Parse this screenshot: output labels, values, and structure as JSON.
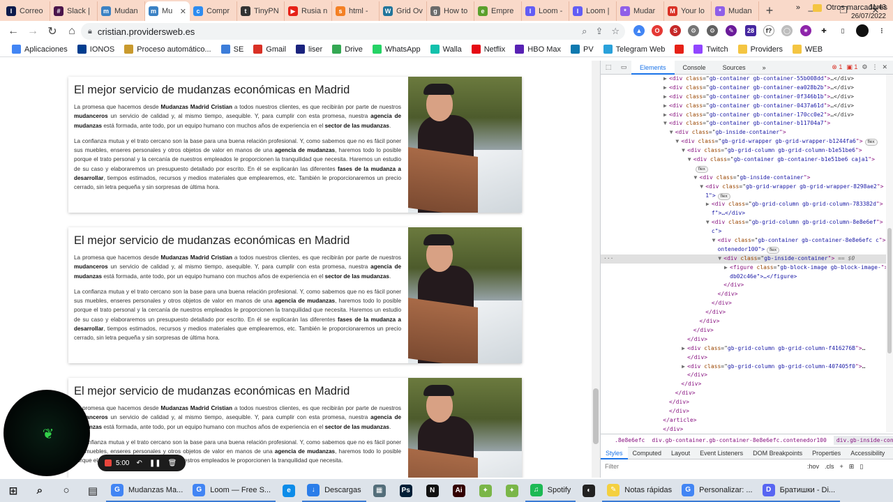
{
  "browser": {
    "tabs": [
      {
        "label": "Correo",
        "icon": "I",
        "color": "#0d1b4c"
      },
      {
        "label": "Slack |",
        "icon": "#",
        "color": "#4a154b"
      },
      {
        "label": "Mudan",
        "icon": "m",
        "color": "#3b82c4"
      },
      {
        "label": "Mu",
        "icon": "m",
        "color": "#3b82c4",
        "active": true
      },
      {
        "label": "Compr",
        "icon": "c",
        "color": "#2d8cf0"
      },
      {
        "label": "TinyPN",
        "icon": "t",
        "color": "#333333"
      },
      {
        "label": "Rusia n",
        "icon": "▶",
        "color": "#e62117"
      },
      {
        "label": "html -",
        "icon": "s",
        "color": "#f48024"
      },
      {
        "label": "Grid Ov",
        "icon": "W",
        "color": "#21759b"
      },
      {
        "label": "How to",
        "icon": "g",
        "color": "#6b6b6b"
      },
      {
        "label": "Empre",
        "icon": "e",
        "color": "#5aa02c"
      },
      {
        "label": "Loom -",
        "icon": "l",
        "color": "#625df5"
      },
      {
        "label": "Loom |",
        "icon": "l",
        "color": "#625df5"
      },
      {
        "label": "Mudar",
        "icon": "*",
        "color": "#8f5fe8"
      },
      {
        "label": "Your lo",
        "icon": "M",
        "color": "#d93025"
      },
      {
        "label": "Mudan",
        "icon": "*",
        "color": "#8f5fe8"
      }
    ],
    "new_tab": "+",
    "url": "cristian.providersweb.es",
    "bookmarks": [
      {
        "label": "Aplicaciones",
        "color": "#4285f4"
      },
      {
        "label": "IONOS",
        "color": "#003d8f"
      },
      {
        "label": "Proceso automático...",
        "color": "#c99a2e"
      },
      {
        "label": "SE",
        "color": "#3c7dd9"
      },
      {
        "label": "Gmail",
        "color": "#d93025"
      },
      {
        "label": "liser",
        "color": "#1a237e"
      },
      {
        "label": "Drive",
        "color": "#34a853"
      },
      {
        "label": "WhatsApp",
        "color": "#25d366"
      },
      {
        "label": "Walla",
        "color": "#13c1ac"
      },
      {
        "label": "Netflix",
        "color": "#e50914"
      },
      {
        "label": "HBO Max",
        "color": "#5822b4"
      },
      {
        "label": "PV",
        "color": "#0f79af"
      },
      {
        "label": "Telegram Web",
        "color": "#2aa1da"
      },
      {
        "label": "",
        "color": "#e62117"
      },
      {
        "label": "Twitch",
        "color": "#9146ff"
      },
      {
        "label": "Providers",
        "color": "#f4c542"
      },
      {
        "label": "WEB",
        "color": "#f4c542"
      }
    ],
    "bookmarks_more": "»",
    "other_bookmarks": "Otros marcadores"
  },
  "page": {
    "cards": [
      {
        "title": "El mejor servicio de mudanzas económicas en Madrid",
        "p1": [
          {
            "t": "La promesa que hacemos desde "
          },
          {
            "t": "Mudanzas Madrid Cristian",
            "b": true
          },
          {
            "t": " a todos nuestros clientes, es que recibirán por parte de nuestros "
          },
          {
            "t": "mudanceros",
            "b": true
          },
          {
            "t": " un servicio de calidad y, al mismo tiempo, asequible. Y, para cumplir con esta promesa, nuestra "
          },
          {
            "t": "agencia de mudanzas",
            "b": true
          },
          {
            "t": " está formada, ante todo, por un equipo humano con muchos años de experiencia en el "
          },
          {
            "t": "sector de las mudanzas",
            "b": true
          },
          {
            "t": "."
          }
        ],
        "p2": [
          {
            "t": "La confianza mutua y el trato cercano son la base para una buena relación profesional. Y, como sabemos que no es fácil poner sus muebles, enseres personales y otros objetos de valor en manos de una "
          },
          {
            "t": "agencia de mudanzas",
            "b": true
          },
          {
            "t": ", haremos todo lo posible porque el trato personal y la cercanía de nuestros empleados le proporcionen la tranquilidad que necesita. Haremos un estudio de su caso y elaboraremos un presupuesto detallado por escrito. En él se explicarán las diferentes "
          },
          {
            "t": "fases de la mudanza a desarrollar",
            "b": true
          },
          {
            "t": ", tiempos estimados, recursos y medios materiales que emplearemos, etc. También le proporcionaremos un precio cerrado, sin letra pequeña y sin sorpresas de última hora."
          }
        ]
      },
      {
        "title": "El mejor servicio de mudanzas económicas en Madrid",
        "p1": [
          {
            "t": "La promesa que hacemos desde "
          },
          {
            "t": "Mudanzas Madrid Cristian",
            "b": true
          },
          {
            "t": " a todos nuestros clientes, es que recibirán por parte de nuestros "
          },
          {
            "t": "mudanceros",
            "b": true
          },
          {
            "t": " un servicio de calidad y, al mismo tiempo, asequible. Y, para cumplir con esta promesa, nuestra "
          },
          {
            "t": "agencia de mudanzas",
            "b": true
          },
          {
            "t": " está formada, ante todo, por un equipo humano con muchos años de experiencia en el "
          },
          {
            "t": "sector de las mudanzas",
            "b": true
          },
          {
            "t": "."
          }
        ],
        "p2": [
          {
            "t": "La confianza mutua y el trato cercano son la base para una buena relación profesional. Y, como sabemos que no es fácil poner sus muebles, enseres personales y otros objetos de valor en manos de una "
          },
          {
            "t": "agencia de mudanzas",
            "b": true
          },
          {
            "t": ", haremos todo lo posible porque el trato personal y la cercanía de nuestros empleados le proporcionen la tranquilidad que necesita. Haremos un estudio de su caso y elaboraremos un presupuesto detallado por escrito. En él se explicarán las diferentes "
          },
          {
            "t": "fases de la mudanza a desarrollar",
            "b": true
          },
          {
            "t": ", tiempos estimados, recursos y medios materiales que emplearemos, etc. También le proporcionaremos un precio cerrado, sin letra pequeña y sin sorpresas de última hora."
          }
        ]
      },
      {
        "title": "El mejor servicio de mudanzas económicas en Madrid",
        "p1": [
          {
            "t": "La promesa que hacemos desde "
          },
          {
            "t": "Mudanzas Madrid Cristian",
            "b": true
          },
          {
            "t": " a todos nuestros clientes, es que recibirán por parte de nuestros "
          },
          {
            "t": "mudanceros",
            "b": true
          },
          {
            "t": " un servicio de calidad y, al mismo tiempo, asequible. Y, para cumplir con esta promesa, nuestra "
          },
          {
            "t": "agencia de mudanzas",
            "b": true
          },
          {
            "t": " está formada, ante todo, por un equipo humano con muchos años de experiencia en el "
          },
          {
            "t": "sector de las mudanzas",
            "b": true
          },
          {
            "t": "."
          }
        ],
        "p2": [
          {
            "t": "La confianza mutua y el trato cercano son la base para una buena relación profesional. Y, como sabemos que no es fácil poner sus muebles, enseres personales y otros objetos de valor en manos de una "
          },
          {
            "t": "agencia de mudanzas",
            "b": true
          },
          {
            "t": ", haremos todo lo posible porque el trato personal y la cercanía de nuestros empleados le proporcionen la tranquilidad que necesita."
          }
        ]
      }
    ]
  },
  "devtools": {
    "tabs": [
      "Elements",
      "Console",
      "Sources",
      "»"
    ],
    "errors": "1",
    "warnings": "1",
    "tree": [
      {
        "i": 0,
        "a": "▶",
        "cls": "gb-container gb-container-55b008dd",
        "tail": "…</div>"
      },
      {
        "i": 0,
        "a": "▶",
        "cls": "gb-container gb-container-ea028b2b",
        "tail": "…</div>"
      },
      {
        "i": 0,
        "a": "▶",
        "cls": "gb-container gb-container-0f346b1b",
        "tail": "…</div>"
      },
      {
        "i": 0,
        "a": "▶",
        "cls": "gb-container gb-container-0437a61d",
        "tail": "…</div>"
      },
      {
        "i": 0,
        "a": "▶",
        "cls": "gb-container gb-container-170cc0e2",
        "tail": "…</div>"
      },
      {
        "i": 0,
        "a": "▼",
        "cls": "gb-container gb-container-b11704a7",
        "tail": ""
      },
      {
        "i": 1,
        "a": "▼",
        "cls": "gb-inside-container",
        "tail": ""
      },
      {
        "i": 2,
        "a": "▼",
        "cls": "gb-grid-wrapper gb-grid-wrapper-b1244fa6",
        "tail": "",
        "badge": "flex"
      },
      {
        "i": 3,
        "a": "▼",
        "cls": "gb-grid-column gb-grid-column-b1e51be6",
        "tail": ""
      },
      {
        "i": 4,
        "a": "▼",
        "cls": "gb-container gb-container-b1e51be6 caja1",
        "tail": ""
      },
      {
        "i": 4,
        "a": "",
        "cls": "",
        "tail": "",
        "badge": "flex",
        "only_badge": true
      },
      {
        "i": 5,
        "a": "▼",
        "cls": "gb-inside-container",
        "tail": ""
      },
      {
        "i": 6,
        "a": "▼",
        "cls": "gb-grid-wrapper gb-grid-wrapper-8298ae2",
        "tail": ""
      },
      {
        "i": 6,
        "a": "",
        "cls": "",
        "raw": "1\">",
        "badge": "flex"
      },
      {
        "i": 7,
        "a": "▶",
        "cls": "gb-grid-column gb-grid-column-783382d",
        "tail": ""
      },
      {
        "i": 7,
        "a": "",
        "cls": "",
        "raw": "f\">…</div>"
      },
      {
        "i": 7,
        "a": "▼",
        "cls": "gb-grid-column gb-grid-column-8e8e6ef",
        "tail": ""
      },
      {
        "i": 7,
        "a": "",
        "cls": "",
        "raw": "c\">"
      },
      {
        "i": 8,
        "a": "▼",
        "cls": "gb-container gb-container-8e8e6efc c",
        "tail": ""
      },
      {
        "i": 8,
        "a": "",
        "cls": "",
        "raw": "ontenedor100\">",
        "badge": "flex"
      },
      {
        "i": 9,
        "a": "▼",
        "cls": "gb-inside-container",
        "tail": "",
        "selected": true,
        "sel": " == $0"
      },
      {
        "i": 10,
        "a": "▶",
        "tag": "figure",
        "cls": "gb-block-image gb-block-image-",
        "tail": ""
      },
      {
        "i": 10,
        "a": "",
        "cls": "",
        "raw": "db02c46e\">…</figure>"
      },
      {
        "i": 9,
        "a": "",
        "close": "div"
      },
      {
        "i": 8,
        "a": "",
        "close": "div"
      },
      {
        "i": 7,
        "a": "",
        "close": "div"
      },
      {
        "i": 6,
        "a": "",
        "close": "div"
      },
      {
        "i": 5,
        "a": "",
        "close": "div"
      },
      {
        "i": 4,
        "a": "",
        "close": "div"
      },
      {
        "i": 3,
        "a": "",
        "close": "div"
      },
      {
        "i": 3,
        "a": "▶",
        "cls": "gb-grid-column gb-grid-column-f416276B",
        "tail": "…"
      },
      {
        "i": 3,
        "a": "",
        "close": "div"
      },
      {
        "i": 3,
        "a": "▶",
        "cls": "gb-grid-column gb-grid-column-407405f0",
        "tail": "…"
      },
      {
        "i": 3,
        "a": "",
        "close": "div"
      },
      {
        "i": 2,
        "a": "",
        "close": "div"
      },
      {
        "i": 1,
        "a": "",
        "close": "div"
      },
      {
        "i": 0,
        "a": "",
        "close": "div"
      },
      {
        "i": 0,
        "a": "",
        "close": "div"
      },
      {
        "i": -1,
        "a": "",
        "close": "article"
      },
      {
        "i": -1,
        "a": "",
        "close": "div"
      }
    ],
    "breadcrumbs": [
      ".8e8e6efc",
      "div.gb-container.gb-container-8e8e6efc.contenedor100",
      "div.gb-inside-container"
    ],
    "styles_tabs": [
      "Styles",
      "Computed",
      "Layout",
      "Event Listeners",
      "DOM Breakpoints",
      "Properties",
      "Accessibility"
    ],
    "filter_placeholder": "Filter",
    "filter_hov": ":hov",
    "filter_cls": ".cls"
  },
  "recorder": {
    "time": "5:00"
  },
  "taskbar": {
    "items": [
      {
        "label": "",
        "color": "#1c1c1c",
        "icon": "⊞"
      },
      {
        "label": "",
        "color": "#1c1c1c",
        "icon": "⌕"
      },
      {
        "label": "",
        "color": "#1c1c1c",
        "icon": "○"
      },
      {
        "label": "",
        "color": "#1c1c1c",
        "icon": "▤"
      },
      {
        "label": "Mudanzas Ma...",
        "color": "#4285f4",
        "icon": "G",
        "open": true
      },
      {
        "label": "Loom — Free S...",
        "color": "#4285f4",
        "icon": "G",
        "open": true
      },
      {
        "label": "",
        "color": "#0c8ce9",
        "icon": "e"
      },
      {
        "label": "Descargas",
        "color": "#2b7de9",
        "icon": "↓",
        "open": true
      },
      {
        "label": "",
        "color": "#546e7a",
        "icon": "▦"
      },
      {
        "label": "",
        "color": "#001e36",
        "icon": "Ps"
      },
      {
        "label": "",
        "color": "#111111",
        "icon": "N"
      },
      {
        "label": "",
        "color": "#330000",
        "icon": "Ai"
      },
      {
        "label": "",
        "color": "#7ab648",
        "icon": "✦"
      },
      {
        "label": "",
        "color": "#7ab648",
        "icon": "✦"
      },
      {
        "label": "Spotify",
        "color": "#1db954",
        "icon": "♫",
        "open": true
      },
      {
        "label": "",
        "color": "#222222",
        "icon": "◐"
      },
      {
        "label": "Notas rápidas",
        "color": "#f4d03f",
        "icon": "✎",
        "open": true
      },
      {
        "label": "Personalizar: ...",
        "color": "#4285f4",
        "icon": "G",
        "open": true
      },
      {
        "label": "Братишки - Di...",
        "color": "#5865f2",
        "icon": "D",
        "open": true
      }
    ],
    "time": "11:43",
    "date": "26/07/2022"
  }
}
